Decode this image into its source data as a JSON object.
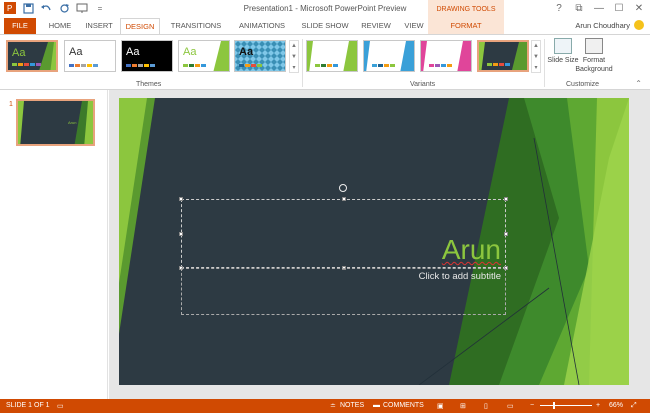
{
  "app": {
    "title": "Presentation1 - Microsoft PowerPoint Preview",
    "contextual_tab_group": "DRAWING TOOLS",
    "user": "Arun Choudhary"
  },
  "window_controls": {
    "help": "?",
    "restore": "⧉",
    "minimize": "—",
    "maximize": "☐",
    "close": "✕"
  },
  "tabs": [
    {
      "label": "FILE"
    },
    {
      "label": "HOME"
    },
    {
      "label": "INSERT"
    },
    {
      "label": "DESIGN"
    },
    {
      "label": "TRANSITIONS"
    },
    {
      "label": "ANIMATIONS"
    },
    {
      "label": "SLIDE SHOW"
    },
    {
      "label": "REVIEW"
    },
    {
      "label": "VIEW"
    },
    {
      "label": "FORMAT"
    }
  ],
  "ribbon": {
    "themes_label": "Themes",
    "variants_label": "Variants",
    "customize_label": "Customize",
    "theme_text": "Aa",
    "slide_size_label": "Slide Size",
    "format_background_label": "Format Background"
  },
  "slide_panel": {
    "number": "1",
    "thumb_text": "Arun"
  },
  "slide": {
    "title": "Arun",
    "subtitle": "Click to add subtitle"
  },
  "status": {
    "slide_info": "SLIDE 1 OF 1",
    "notes": "NOTES",
    "comments": "COMMENTS",
    "zoom": "66%"
  },
  "colors": {
    "accent": "#d04a02",
    "slide_bg": "#2d3a43",
    "title_green": "#8cc63e"
  }
}
